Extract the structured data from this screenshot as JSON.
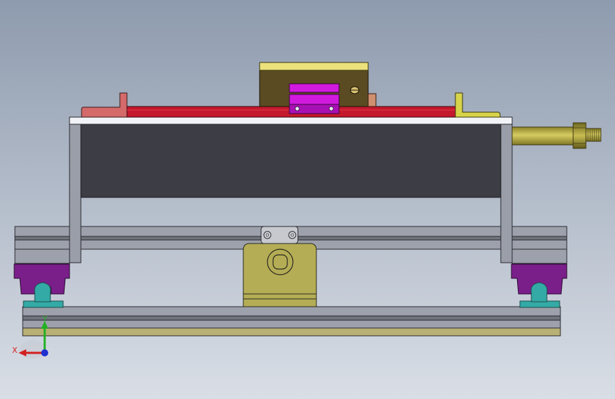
{
  "viewport": {
    "background_top": "#8e9bae",
    "background_bottom": "#d9dee6"
  },
  "triad": {
    "x_label": "X",
    "y_label": "Y",
    "x_color": "#d42020",
    "y_color": "#22b022",
    "z_color": "#2030d0"
  },
  "colors": {
    "steel_dark": "#3c3d45",
    "steel_plate": "#f2f3f6",
    "frame_grey": "#9a9ea8",
    "rail_purple": "#7a1f8a",
    "carriage_teal": "#33aaa6",
    "block_olive": "#b5ad55",
    "base_strip": "#b8b075",
    "red_bar": "#c4182c",
    "left_bracket": "#d46a6a",
    "right_bracket": "#d8d44a",
    "body_brown": "#5a4b22",
    "cap_yellow": "#ece27c",
    "magenta": "#d21adf",
    "screw_olive": "#b7ab3c"
  }
}
